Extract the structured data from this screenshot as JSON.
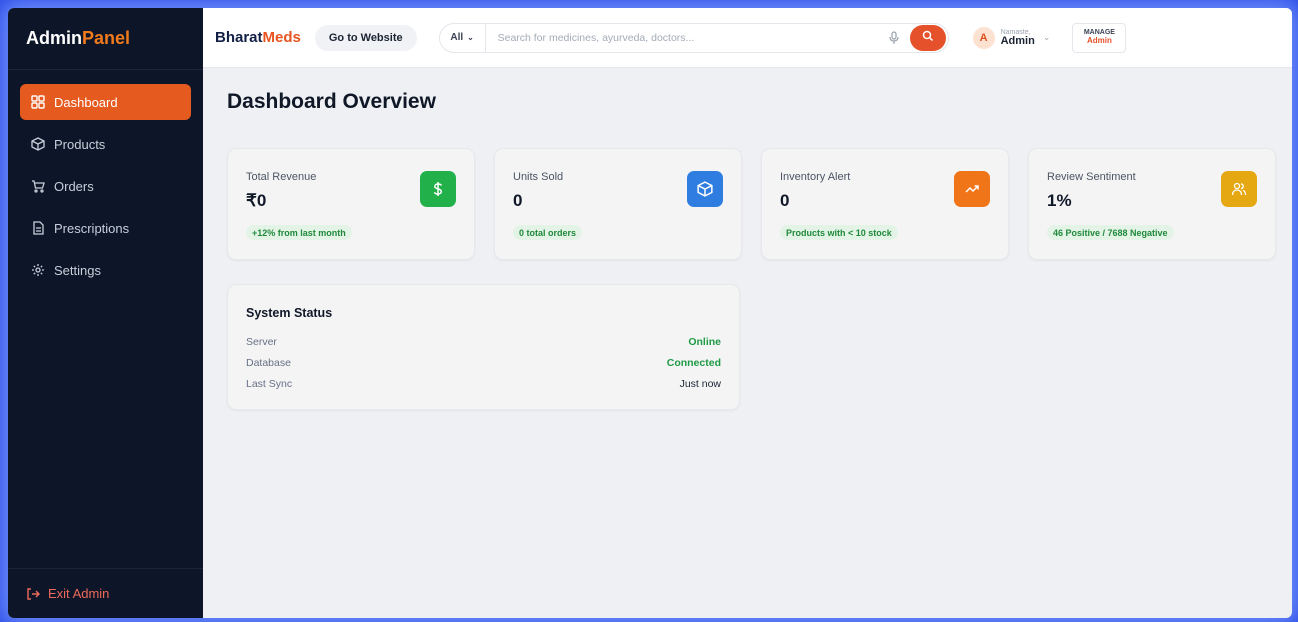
{
  "sidebar": {
    "brand_main": "Admin",
    "brand_accent": "Panel",
    "items": [
      {
        "label": "Dashboard",
        "icon": "grid-icon",
        "active": true
      },
      {
        "label": "Products",
        "icon": "box-icon"
      },
      {
        "label": "Orders",
        "icon": "cart-icon"
      },
      {
        "label": "Prescriptions",
        "icon": "document-icon"
      },
      {
        "label": "Settings",
        "icon": "gear-icon"
      }
    ],
    "exit_label": "Exit Admin"
  },
  "topbar": {
    "brand_main": "Bharat",
    "brand_accent": "Meds",
    "go_website": "Go to Website",
    "search_category": "All",
    "search_placeholder": "Search for medicines, ayurveda, doctors...",
    "avatar_letter": "A",
    "greeting": "Namaste,",
    "user_name": "Admin",
    "manage_top": "MANAGE",
    "manage_bottom": "Admin"
  },
  "main": {
    "title": "Dashboard Overview",
    "stats": [
      {
        "label": "Total Revenue",
        "value": "₹0",
        "badge": "+12% from last month",
        "icon": "dollar-icon",
        "color": "#22b04b"
      },
      {
        "label": "Units Sold",
        "value": "0",
        "badge": "0 total orders",
        "icon": "box-icon",
        "color": "#2f7de1"
      },
      {
        "label": "Inventory Alert",
        "value": "0",
        "badge": "Products with < 10 stock",
        "icon": "trend-up-icon",
        "color": "#f07519"
      },
      {
        "label": "Review Sentiment",
        "value": "1%",
        "badge": "46 Positive / 7688 Negative",
        "icon": "users-icon",
        "color": "#e6a812"
      }
    ],
    "system_status": {
      "title": "System Status",
      "rows": [
        {
          "key": "Server",
          "value": "Online",
          "color": "#1f9a45"
        },
        {
          "key": "Database",
          "value": "Connected",
          "color": "#1f9a45"
        },
        {
          "key": "Last Sync",
          "value": "Just now",
          "color": "#1b2433"
        }
      ]
    }
  },
  "colors": {
    "accent": "#e55a1f",
    "sidebar_bg": "#0c1628",
    "success": "#1f9a45"
  }
}
